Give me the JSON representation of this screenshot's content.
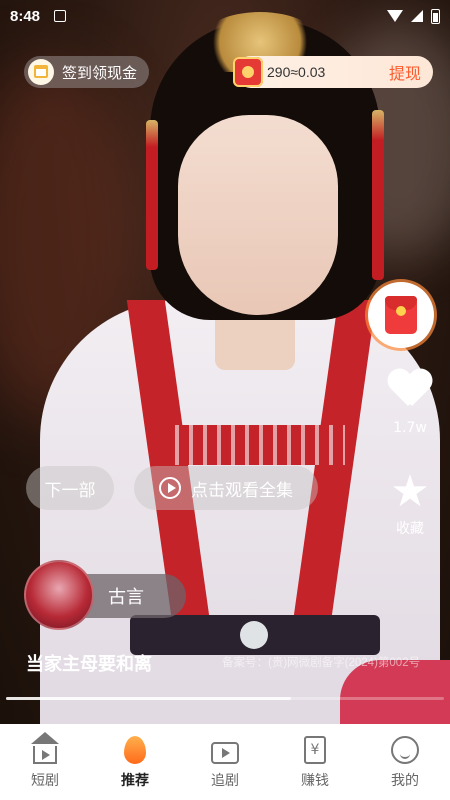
{
  "status_bar": {
    "time": "8:48"
  },
  "top": {
    "checkin_label": "签到领现金",
    "coins_text": "290≈0.03",
    "withdraw_label": "提现"
  },
  "rail": {
    "like_count": "1.7w",
    "favorite_label": "收藏"
  },
  "actions": {
    "next_label": "下一部",
    "watch_all_label": "点击观看全集"
  },
  "drama": {
    "genre": "古言",
    "title": "当家主母要和离",
    "filing": "备案号：(贵)网微剧备字(2024)第002号",
    "progress": 0.65
  },
  "nav": {
    "items": [
      {
        "label": "短剧",
        "icon": "short-drama-icon"
      },
      {
        "label": "推荐",
        "icon": "flame-icon"
      },
      {
        "label": "追剧",
        "icon": "tv-icon"
      },
      {
        "label": "赚钱",
        "icon": "money-icon"
      },
      {
        "label": "我的",
        "icon": "profile-icon"
      }
    ],
    "active": "推荐"
  },
  "colors": {
    "accent": "#ff5a2c",
    "red_packet": "#ef3b3b"
  }
}
